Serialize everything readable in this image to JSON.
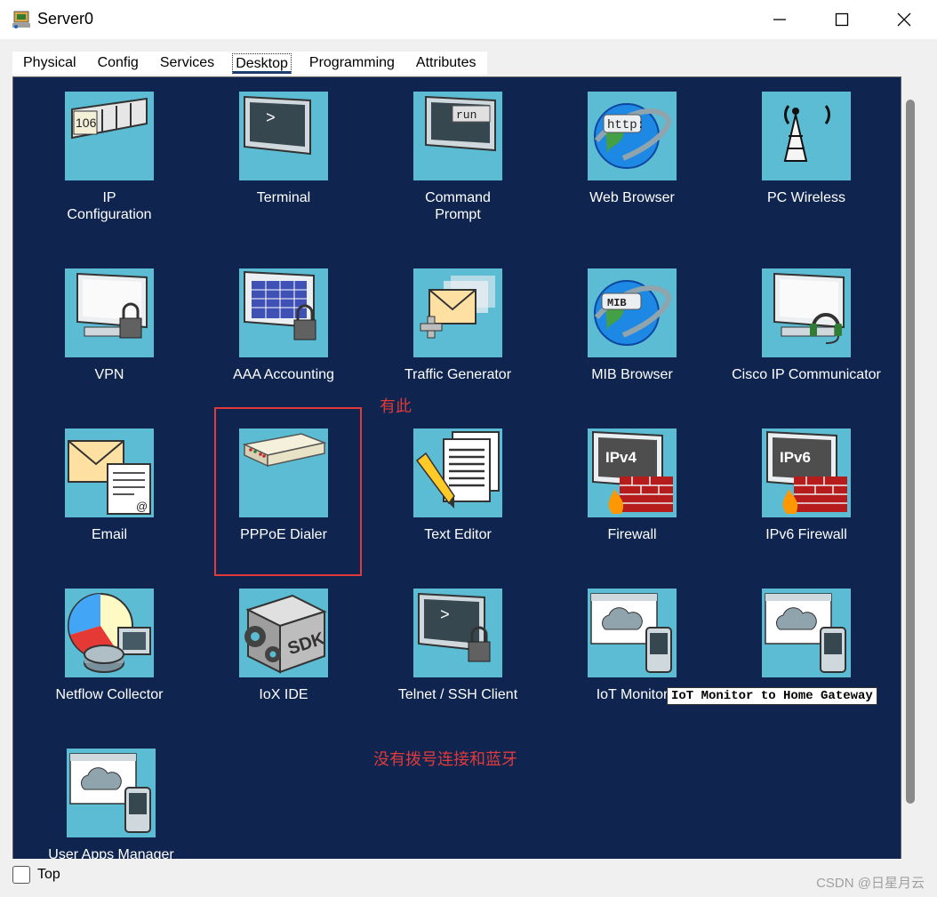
{
  "window": {
    "title": "Server0",
    "minimize": "—",
    "maximize": "☐",
    "close": "✕"
  },
  "tabs": [
    {
      "label": "Physical"
    },
    {
      "label": "Config"
    },
    {
      "label": "Services"
    },
    {
      "label": "Desktop",
      "active": true
    },
    {
      "label": "Programming"
    },
    {
      "label": "Attributes"
    }
  ],
  "apps": [
    {
      "label": "IP\nConfiguration",
      "icon": "ip-config-icon"
    },
    {
      "label": "Terminal",
      "icon": "terminal-icon"
    },
    {
      "label": "Command\nPrompt",
      "icon": "command-prompt-icon"
    },
    {
      "label": "Web Browser",
      "icon": "web-browser-icon"
    },
    {
      "label": "PC Wireless",
      "icon": "wireless-tower-icon"
    },
    {
      "label": "VPN",
      "icon": "vpn-lock-icon"
    },
    {
      "label": "AAA Accounting",
      "icon": "aaa-accounting-icon"
    },
    {
      "label": "Traffic Generator",
      "icon": "traffic-generator-icon"
    },
    {
      "label": "MIB Browser",
      "icon": "mib-browser-icon"
    },
    {
      "label": "Cisco IP Communicator",
      "icon": "ip-communicator-icon"
    },
    {
      "label": "Email",
      "icon": "email-icon"
    },
    {
      "label": "PPPoE Dialer",
      "icon": "pppoe-dialer-icon"
    },
    {
      "label": "Text Editor",
      "icon": "text-editor-icon"
    },
    {
      "label": "Firewall",
      "icon": "firewall-icon"
    },
    {
      "label": "IPv6 Firewall",
      "icon": "ipv6-firewall-icon"
    },
    {
      "label": "Netflow Collector",
      "icon": "netflow-icon"
    },
    {
      "label": "IoX IDE",
      "icon": "sdk-icon"
    },
    {
      "label": "Telnet / SSH Client",
      "icon": "telnet-ssh-icon"
    },
    {
      "label": "IoT Monitor",
      "icon": "iot-monitor-icon"
    },
    {
      "label": "",
      "icon": "home-gateway-icon"
    },
    {
      "label": "User Apps Manager",
      "icon": "user-apps-icon"
    }
  ],
  "icon_text": {
    "ip": "106",
    "terminal": ">",
    "run": "run",
    "http": "http:",
    "mib": "MIB",
    "ipv4": "IPv4",
    "ipv6": "IPv6",
    "sdk": "SDK",
    "email_at": "@"
  },
  "tooltip": "IoT Monitor to Home Gateway",
  "annotations": {
    "has_this": "有此",
    "missing": "没有拨号连接和蓝牙"
  },
  "bottom": {
    "top_label": "Top",
    "top_checked": false,
    "watermark": "CSDN @日星月云"
  },
  "colors": {
    "desktop_bg": "#0f2550",
    "tile_bg": "#5bbcd4",
    "annotation": "#e03a3a"
  }
}
